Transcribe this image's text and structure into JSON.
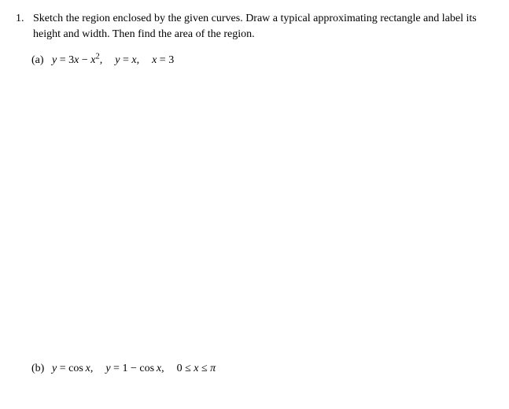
{
  "problem": {
    "number": "1.",
    "text": "Sketch the region enclosed by the given curves. Draw a typical approximating rectangle and label its height and width. Then find the area of the region.",
    "parts": {
      "a": {
        "label": "(a)",
        "eq1_lhs": "y",
        "eq1_rhs_coef": "3",
        "eq1_rhs_var1": "x",
        "eq1_rhs_var2": "x",
        "eq1_rhs_exp": "2",
        "eq2_lhs": "y",
        "eq2_rhs": "x",
        "eq3_lhs": "x",
        "eq3_rhs": "3"
      },
      "b": {
        "label": "(b)",
        "eq1_lhs": "y",
        "eq1_fn": "cos",
        "eq1_var": "x",
        "eq2_lhs": "y",
        "eq2_const": "1",
        "eq2_fn": "cos",
        "eq2_var": "x",
        "ineq_lo": "0",
        "ineq_var": "x",
        "ineq_hi": "π"
      }
    }
  }
}
